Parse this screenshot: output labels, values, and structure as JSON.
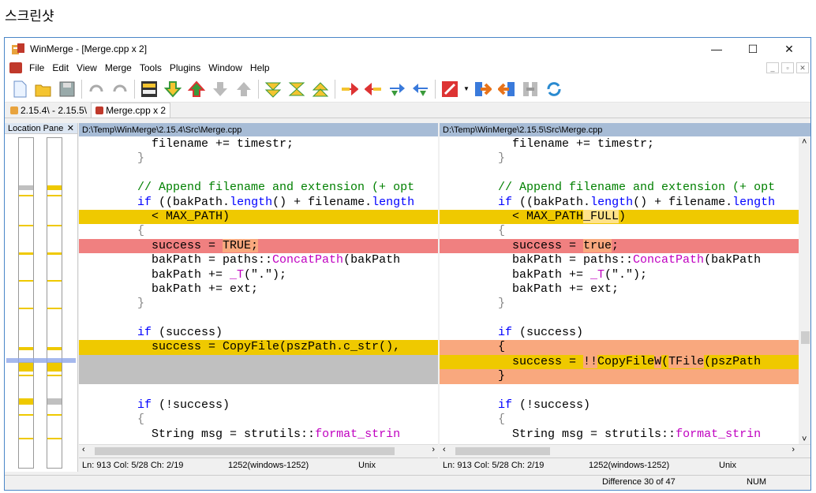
{
  "caption": "스크린샷",
  "window": {
    "title": "WinMerge - [Merge.cpp x 2]",
    "minimize": "—",
    "maximize": "☐",
    "close": "✕"
  },
  "menu": [
    "File",
    "Edit",
    "View",
    "Merge",
    "Tools",
    "Plugins",
    "Window",
    "Help"
  ],
  "mdi": {
    "min": "_",
    "restore": "▫",
    "close": "✕"
  },
  "tabs": [
    {
      "label": "2.15.4\\ - 2.15.5\\",
      "active": false
    },
    {
      "label": "Merge.cpp x 2",
      "active": true
    }
  ],
  "location_pane": {
    "title": "Location Pane",
    "close": "✕"
  },
  "left": {
    "path": "D:\\Temp\\WinMerge\\2.15.4\\Src\\Merge.cpp",
    "status": {
      "pos": "Ln: 913  Col: 5/28  Ch: 2/19",
      "enc": "1252(windows-1252)",
      "eol": "Unix"
    }
  },
  "right": {
    "path": "D:\\Temp\\WinMerge\\2.15.5\\Src\\Merge.cpp",
    "status": {
      "pos": "Ln: 913  Col: 5/28  Ch: 2/19",
      "enc": "1252(windows-1252)",
      "eol": "Unix"
    }
  },
  "bottom": {
    "difference": "Difference 30 of 47",
    "num": "NUM"
  },
  "colors": {
    "diff": "#efc900",
    "moved": "#f08080",
    "missing": "#c0c0c0",
    "header": "#a7bcd6"
  }
}
